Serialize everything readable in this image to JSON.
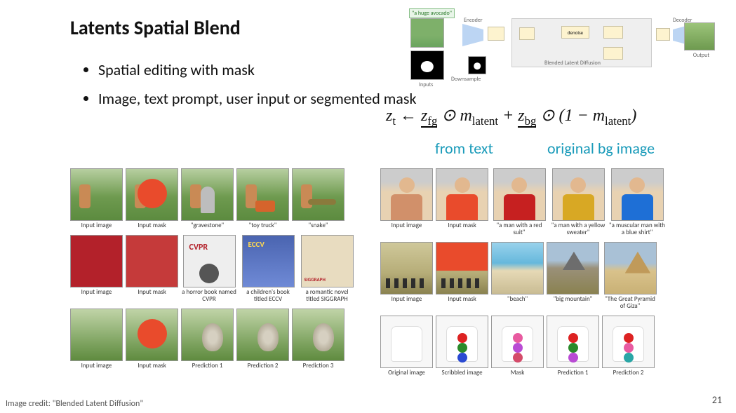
{
  "title": "Latents Spatial Blend",
  "bullets": [
    "Spatial editing with mask",
    "Image, text prompt, user input or segmented mask"
  ],
  "equation": {
    "lhs": "z",
    "lhs_sub": "t",
    "arrow": "←",
    "zfg": "z",
    "zfg_sub": "fg",
    "odot": "⊙",
    "m": "m",
    "m_sub": "latent",
    "plus": "+",
    "zbg": "z",
    "zbg_sub": "bg",
    "one_minus_open": "(1 −",
    "close": ")"
  },
  "eq_labels": {
    "from_text": "from text",
    "orig_bg": "original bg image"
  },
  "diagram": {
    "prompt_tag": "\"a huge avocado\"",
    "inputs_label": "Inputs",
    "encoder_label": "Encoder",
    "decoder_label": "Decoder",
    "output_label": "Output",
    "bld_label": "Blended Latent Diffusion",
    "downsample_label": "Downsample",
    "denoise_label": "denoise"
  },
  "gallery": {
    "left": [
      {
        "cells": [
          {
            "cls": "grass",
            "cap": "Input image"
          },
          {
            "cls": "grass grass-mask",
            "cap": "Input mask"
          },
          {
            "cls": "grass gravestone",
            "cap": "\"gravestone\""
          },
          {
            "cls": "grass toytruck",
            "cap": "\"toy truck\""
          },
          {
            "cls": "grass snake",
            "cap": "\"snake\""
          }
        ]
      },
      {
        "cells": [
          {
            "cls": "book",
            "cap": "Input image"
          },
          {
            "cls": "book plain",
            "cap": "Input mask"
          },
          {
            "cls": "book-cvpr",
            "cap": "a horror book named CVPR"
          },
          {
            "cls": "book-eccv",
            "cap": "a children's book titled ECCV"
          },
          {
            "cls": "book-sigg",
            "cap": "a romantic novel titled SIGGRAPH"
          }
        ]
      },
      {
        "cells": [
          {
            "cls": "rocks",
            "cap": "Input image"
          },
          {
            "cls": "rocks grass-mask",
            "cap": "Input mask"
          },
          {
            "cls": "rocks pred",
            "cap": "Prediction 1"
          },
          {
            "cls": "rocks pred",
            "cap": "Prediction 2"
          },
          {
            "cls": "rocks pred",
            "cap": "Prediction 3"
          }
        ]
      }
    ],
    "right": [
      {
        "cells": [
          {
            "cls": "man man-input",
            "cap": "Input image"
          },
          {
            "cls": "man man-mask",
            "cap": "Input mask"
          },
          {
            "cls": "man man-red",
            "cap": "\"a man with a red suit\""
          },
          {
            "cls": "man man-yellow",
            "cap": "\"a man with a yellow sweater\""
          },
          {
            "cls": "man man-blue",
            "cap": "\"a muscular man with a blue shirt\""
          }
        ]
      },
      {
        "cells": [
          {
            "cls": "field",
            "cap": "Input image"
          },
          {
            "cls": "field field-mask",
            "cap": "Input mask"
          },
          {
            "cls": "beach",
            "cap": "\"beach\""
          },
          {
            "cls": "mountain",
            "cap": "\"big mountain\""
          },
          {
            "cls": "pyramid",
            "cap": "\"The Great Pyramid of Giza\""
          }
        ]
      },
      {
        "cells": [
          {
            "cls": "tshirt",
            "cap": "Original image"
          },
          {
            "cls": "tshirt ts-rgb",
            "cap": "Scribbled image"
          },
          {
            "cls": "tshirt ts-phr",
            "cap": "Mask"
          },
          {
            "cls": "tshirt ts-rgp",
            "cap": "Prediction 1"
          },
          {
            "cls": "tshirt ts-rpt",
            "cap": "Prediction 2"
          }
        ]
      }
    ]
  },
  "footer_credit": "Image credit: \"Blended Latent Diffusion\"",
  "page_number": "21"
}
